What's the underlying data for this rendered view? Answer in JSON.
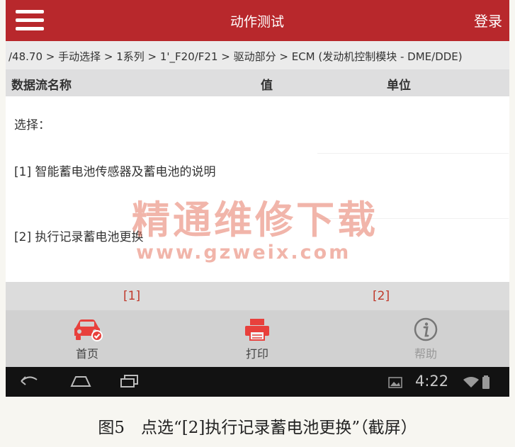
{
  "header": {
    "title": "动作测试",
    "login_label": "登录"
  },
  "breadcrumb": "/48.70 > 手动选择 > 1系列 > 1'_F20/F21 > 驱动部分 > ECM (发动机控制模块 - DME/DDE)",
  "table": {
    "columns": [
      "数据流名称",
      "值",
      "单位"
    ]
  },
  "content": {
    "label": "选择：",
    "options": [
      "[1] 智能蓄电池传感器及蓄电池的说明",
      "[2] 执行记录蓄电池更换"
    ]
  },
  "watermark": {
    "main": "精通维修下载",
    "url": "www.gzweix.com"
  },
  "key_row": {
    "key1": "[1]",
    "key2": "[2]"
  },
  "toolbar": {
    "home_label": "首页",
    "print_label": "打印",
    "help_label": "帮助"
  },
  "statusbar": {
    "time": "4:22"
  },
  "colors": {
    "header": "#b8282c",
    "accent": "#e8403c",
    "key_text": "#c0392b"
  },
  "caption": "图5　点选“[2]执行记录蓄电池更换”（截屏）"
}
